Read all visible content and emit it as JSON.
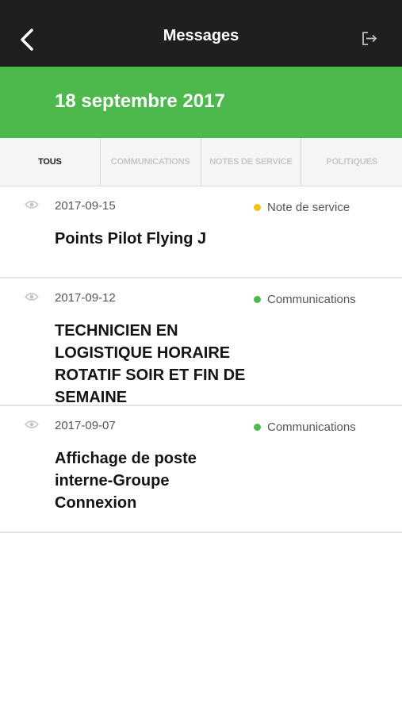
{
  "header": {
    "title": "Messages",
    "back_icon": "chevron-left-icon",
    "logout_icon": "logout-icon"
  },
  "banner": {
    "date": "18 septembre 2017",
    "color": "#4db84c"
  },
  "tabs": [
    {
      "label": "TOUS",
      "active": true
    },
    {
      "label": "COMMUNICATIONS",
      "active": false
    },
    {
      "label": "NOTES DE SERVICE",
      "active": false
    },
    {
      "label": "POLITIQUES",
      "active": false
    }
  ],
  "messages": [
    {
      "date": "2017-09-15",
      "category": "Note de service",
      "category_color": "#f2c21b",
      "title": "Points Pilot Flying J"
    },
    {
      "date": "2017-09-12",
      "category": "Communications",
      "category_color": "#4db84c",
      "title": "TECHNICIEN EN LOGISTIQUE HORAIRE ROTATIF SOIR ET FIN DE SEMAINE"
    },
    {
      "date": "2017-09-07",
      "category": "Communications",
      "category_color": "#4db84c",
      "title": "Affichage de poste interne-Groupe Connexion"
    }
  ]
}
